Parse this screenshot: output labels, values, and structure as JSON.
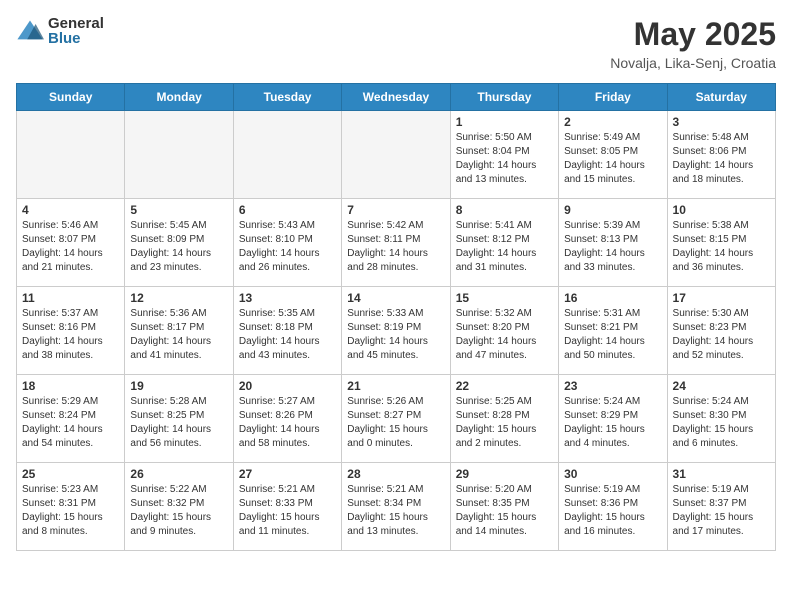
{
  "header": {
    "logo_general": "General",
    "logo_blue": "Blue",
    "month_year": "May 2025",
    "location": "Novalja, Lika-Senj, Croatia"
  },
  "days_of_week": [
    "Sunday",
    "Monday",
    "Tuesday",
    "Wednesday",
    "Thursday",
    "Friday",
    "Saturday"
  ],
  "weeks": [
    [
      {
        "day": "",
        "info": ""
      },
      {
        "day": "",
        "info": ""
      },
      {
        "day": "",
        "info": ""
      },
      {
        "day": "",
        "info": ""
      },
      {
        "day": "1",
        "info": "Sunrise: 5:50 AM\nSunset: 8:04 PM\nDaylight: 14 hours\nand 13 minutes."
      },
      {
        "day": "2",
        "info": "Sunrise: 5:49 AM\nSunset: 8:05 PM\nDaylight: 14 hours\nand 15 minutes."
      },
      {
        "day": "3",
        "info": "Sunrise: 5:48 AM\nSunset: 8:06 PM\nDaylight: 14 hours\nand 18 minutes."
      }
    ],
    [
      {
        "day": "4",
        "info": "Sunrise: 5:46 AM\nSunset: 8:07 PM\nDaylight: 14 hours\nand 21 minutes."
      },
      {
        "day": "5",
        "info": "Sunrise: 5:45 AM\nSunset: 8:09 PM\nDaylight: 14 hours\nand 23 minutes."
      },
      {
        "day": "6",
        "info": "Sunrise: 5:43 AM\nSunset: 8:10 PM\nDaylight: 14 hours\nand 26 minutes."
      },
      {
        "day": "7",
        "info": "Sunrise: 5:42 AM\nSunset: 8:11 PM\nDaylight: 14 hours\nand 28 minutes."
      },
      {
        "day": "8",
        "info": "Sunrise: 5:41 AM\nSunset: 8:12 PM\nDaylight: 14 hours\nand 31 minutes."
      },
      {
        "day": "9",
        "info": "Sunrise: 5:39 AM\nSunset: 8:13 PM\nDaylight: 14 hours\nand 33 minutes."
      },
      {
        "day": "10",
        "info": "Sunrise: 5:38 AM\nSunset: 8:15 PM\nDaylight: 14 hours\nand 36 minutes."
      }
    ],
    [
      {
        "day": "11",
        "info": "Sunrise: 5:37 AM\nSunset: 8:16 PM\nDaylight: 14 hours\nand 38 minutes."
      },
      {
        "day": "12",
        "info": "Sunrise: 5:36 AM\nSunset: 8:17 PM\nDaylight: 14 hours\nand 41 minutes."
      },
      {
        "day": "13",
        "info": "Sunrise: 5:35 AM\nSunset: 8:18 PM\nDaylight: 14 hours\nand 43 minutes."
      },
      {
        "day": "14",
        "info": "Sunrise: 5:33 AM\nSunset: 8:19 PM\nDaylight: 14 hours\nand 45 minutes."
      },
      {
        "day": "15",
        "info": "Sunrise: 5:32 AM\nSunset: 8:20 PM\nDaylight: 14 hours\nand 47 minutes."
      },
      {
        "day": "16",
        "info": "Sunrise: 5:31 AM\nSunset: 8:21 PM\nDaylight: 14 hours\nand 50 minutes."
      },
      {
        "day": "17",
        "info": "Sunrise: 5:30 AM\nSunset: 8:23 PM\nDaylight: 14 hours\nand 52 minutes."
      }
    ],
    [
      {
        "day": "18",
        "info": "Sunrise: 5:29 AM\nSunset: 8:24 PM\nDaylight: 14 hours\nand 54 minutes."
      },
      {
        "day": "19",
        "info": "Sunrise: 5:28 AM\nSunset: 8:25 PM\nDaylight: 14 hours\nand 56 minutes."
      },
      {
        "day": "20",
        "info": "Sunrise: 5:27 AM\nSunset: 8:26 PM\nDaylight: 14 hours\nand 58 minutes."
      },
      {
        "day": "21",
        "info": "Sunrise: 5:26 AM\nSunset: 8:27 PM\nDaylight: 15 hours\nand 0 minutes."
      },
      {
        "day": "22",
        "info": "Sunrise: 5:25 AM\nSunset: 8:28 PM\nDaylight: 15 hours\nand 2 minutes."
      },
      {
        "day": "23",
        "info": "Sunrise: 5:24 AM\nSunset: 8:29 PM\nDaylight: 15 hours\nand 4 minutes."
      },
      {
        "day": "24",
        "info": "Sunrise: 5:24 AM\nSunset: 8:30 PM\nDaylight: 15 hours\nand 6 minutes."
      }
    ],
    [
      {
        "day": "25",
        "info": "Sunrise: 5:23 AM\nSunset: 8:31 PM\nDaylight: 15 hours\nand 8 minutes."
      },
      {
        "day": "26",
        "info": "Sunrise: 5:22 AM\nSunset: 8:32 PM\nDaylight: 15 hours\nand 9 minutes."
      },
      {
        "day": "27",
        "info": "Sunrise: 5:21 AM\nSunset: 8:33 PM\nDaylight: 15 hours\nand 11 minutes."
      },
      {
        "day": "28",
        "info": "Sunrise: 5:21 AM\nSunset: 8:34 PM\nDaylight: 15 hours\nand 13 minutes."
      },
      {
        "day": "29",
        "info": "Sunrise: 5:20 AM\nSunset: 8:35 PM\nDaylight: 15 hours\nand 14 minutes."
      },
      {
        "day": "30",
        "info": "Sunrise: 5:19 AM\nSunset: 8:36 PM\nDaylight: 15 hours\nand 16 minutes."
      },
      {
        "day": "31",
        "info": "Sunrise: 5:19 AM\nSunset: 8:37 PM\nDaylight: 15 hours\nand 17 minutes."
      }
    ]
  ]
}
